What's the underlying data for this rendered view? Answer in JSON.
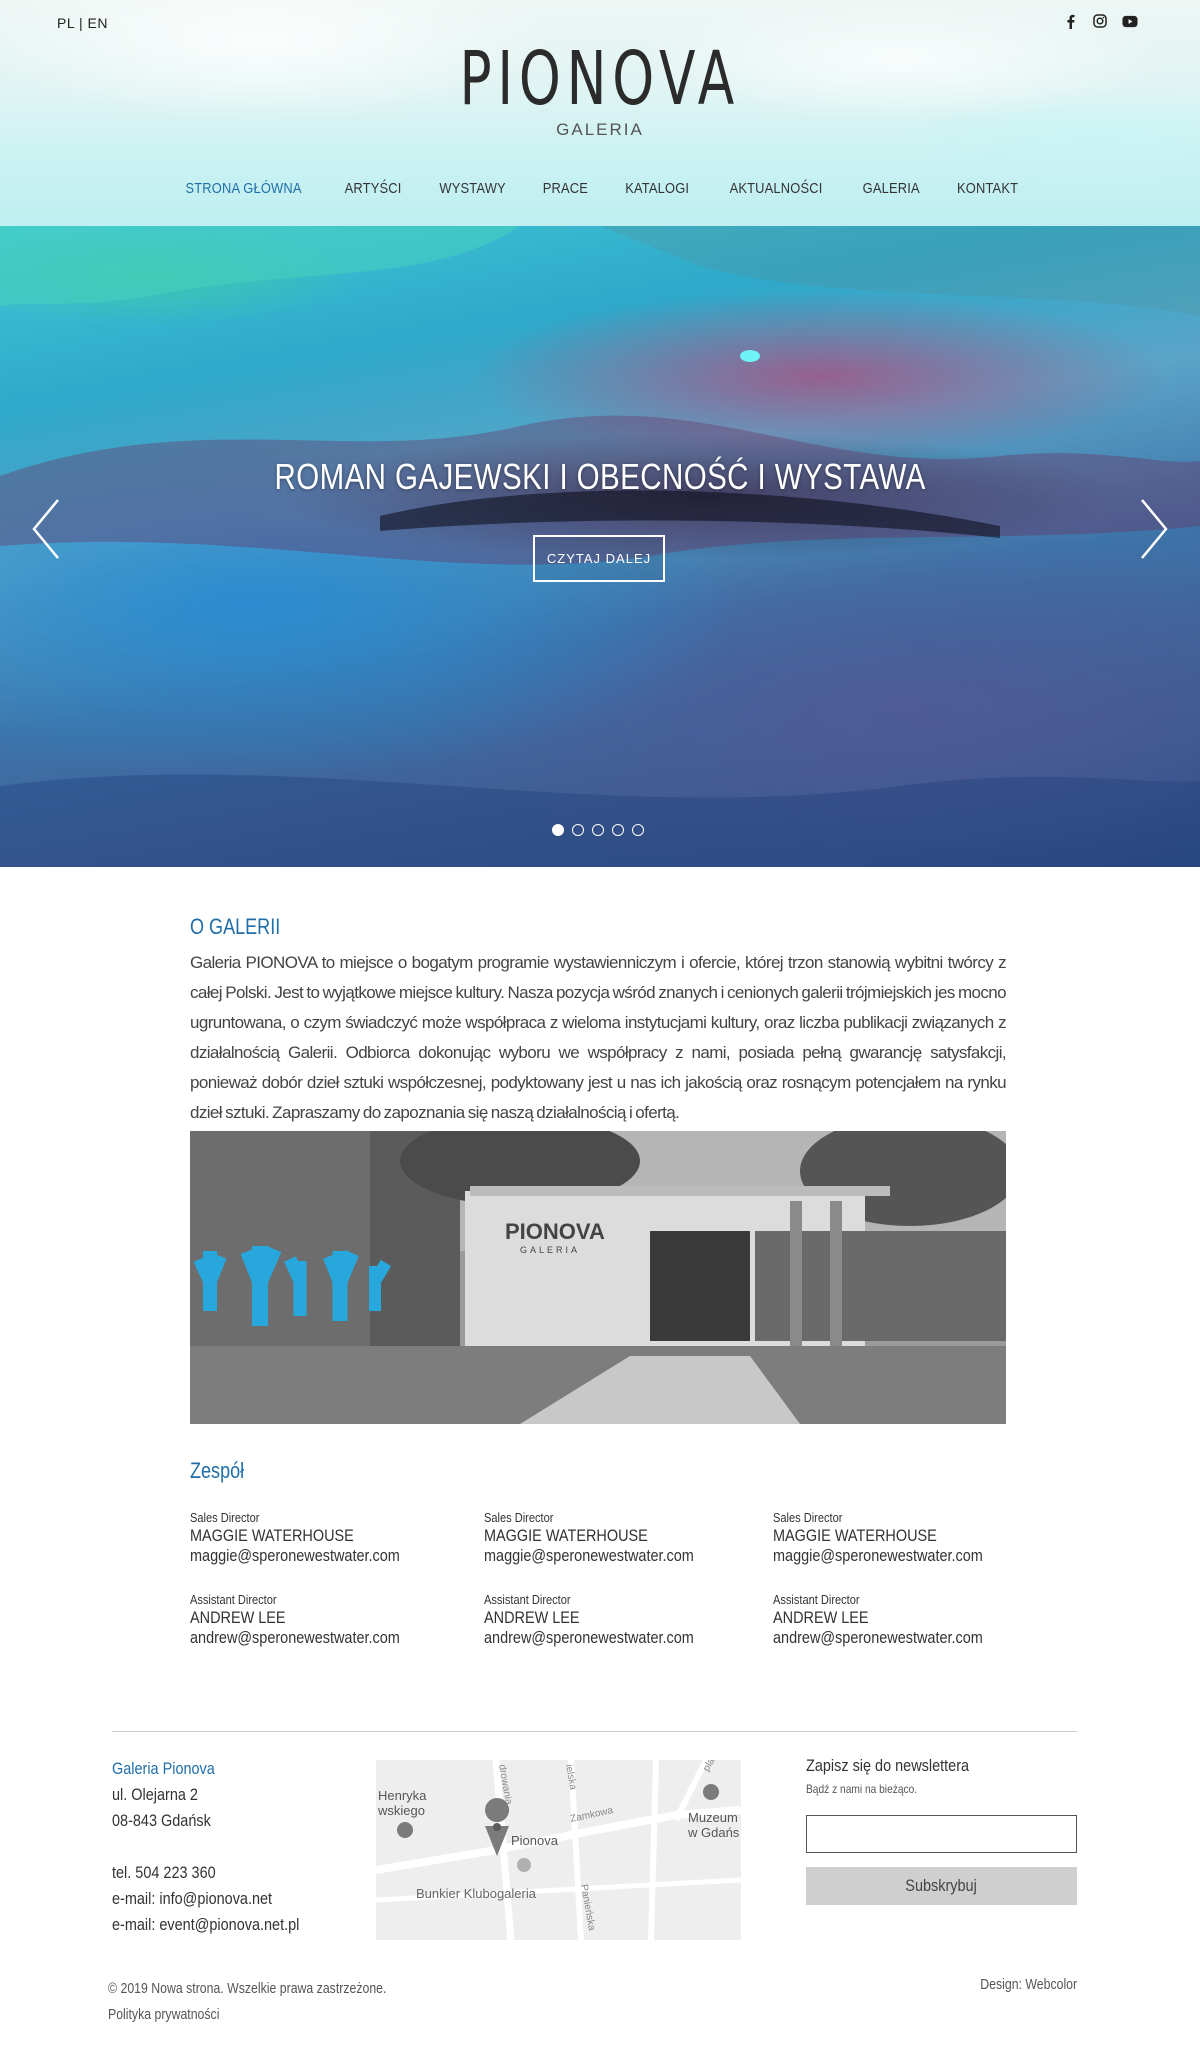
{
  "header": {
    "lang": "PL | EN",
    "logo_title": "PIONOVA",
    "logo_sub": "GALERIA",
    "social": [
      "facebook-icon",
      "instagram-icon",
      "youtube-icon"
    ]
  },
  "nav": {
    "items": [
      {
        "label": "STRONA GŁÓWNA",
        "active": true
      },
      {
        "label": "ARTYŚCI"
      },
      {
        "label": "WYSTAWY"
      },
      {
        "label": "PRACE"
      },
      {
        "label": "KATALOGI"
      },
      {
        "label": "AKTUALNOŚCI"
      },
      {
        "label": "GALERIA"
      },
      {
        "label": "KONTAKT"
      }
    ]
  },
  "hero": {
    "title": "ROMAN GAJEWSKI I OBECNOŚĆ I WYSTAWA",
    "button": "CZYTAJ DALEJ",
    "slide_count": 5,
    "active_slide": 1
  },
  "about": {
    "title": "O GALERII",
    "text": "Galeria PIONOVA to miejsce o bogatym programie wystawienniczym i ofercie, której trzon stanowią wybitni twórcy z całej Polski. Jest to wyjątkowe miejsce kultury. Nasza pozycja wśród znanych i cenionych galerii trójmiejskich jes mocno ugruntowana, o czym świadczyć może współpraca z wieloma instytucjami kultury, oraz liczba publikacji związanych z działalnością Galerii. Odbiorca dokonując wyboru we współpracy z nami, posiada pełną gwarancję satysfakcji, ponieważ dobór dzieł sztuki współczesnej, podyktowany jest u nas ich jakością oraz rosnącym potencjałem na rynku dzieł sztuki. Zapraszamy do zapoznania się  naszą działalnością i ofertą.",
    "photo_sign": "PIONOVA",
    "photo_sign_sub": "GALERIA"
  },
  "team": {
    "title": "Zespół",
    "members": [
      {
        "role": "Sales Director",
        "name": "MAGGIE WATERHOUSE",
        "email": "maggie@speronewestwater.com"
      },
      {
        "role": "Sales Director",
        "name": "MAGGIE WATERHOUSE",
        "email": "maggie@speronewestwater.com"
      },
      {
        "role": "Sales Director",
        "name": "MAGGIE WATERHOUSE",
        "email": "maggie@speronewestwater.com"
      },
      {
        "role": "Assistant Director",
        "name": "ANDREW LEE",
        "email": "andrew@speronewestwater.com"
      },
      {
        "role": "Assistant Director",
        "name": "ANDREW LEE",
        "email": "andrew@speronewestwater.com"
      },
      {
        "role": "Assistant Director",
        "name": "ANDREW LEE",
        "email": "andrew@speronewestwater.com"
      }
    ]
  },
  "footer": {
    "gallery_name": "Galeria Pionova",
    "street": "ul. Olejarna 2",
    "city": "08-843 Gdańsk",
    "phone": "tel. 504 223 360",
    "email1": "e-mail:  info@pionova.net",
    "email2": "e-mail: event@pionova.net.pl",
    "map_labels": {
      "henryka": "Henryka",
      "wskiego": "wskiego",
      "pionova": "Pionova",
      "bunkier": "Bunkier Klubogaleria",
      "muzeum1": "Muzeum",
      "muzeum2": "w Gdańs",
      "zamkowa": "Zamkowa",
      "street1": "drowania",
      "street2": "ielska",
      "street3": "Panieńska",
      "street4": "plac"
    },
    "newsletter_title": "Zapisz się do newslettera",
    "newsletter_sub": "Bądź z nami na bieżąco.",
    "newsletter_placeholder": "",
    "subscribe": "Subskrybuj",
    "copyright": "© 2019 Nowa strona. Wszelkie prawa zastrzeżone.",
    "privacy": "Polityka prywatności",
    "design": "Design: Webcolor"
  }
}
